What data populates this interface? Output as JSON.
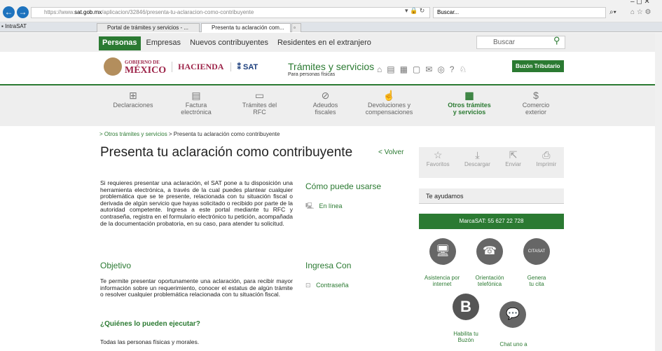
{
  "browser": {
    "url_prefix": "https://www.",
    "url_domain": "sat.gob.mx",
    "url_path": "/aplicacion/32846/presenta-tu-aclaracion-como-contribuyente",
    "search_placeholder": "Buscar...",
    "favorites_label": "IntraSAT",
    "tabs": [
      {
        "label": "Portal de trámites y servicios - ..."
      },
      {
        "label": "Presenta tu aclaración com..."
      }
    ]
  },
  "topnav": {
    "items": [
      "Personas",
      "Empresas",
      "Nuevos contribuyentes",
      "Residentes en el extranjero"
    ],
    "search_placeholder": "Buscar"
  },
  "header": {
    "gob_line1": "GOBIERNO DE",
    "gob_line2": "MÉXICO",
    "hacienda": "HACIENDA",
    "sat": "SAT",
    "tramites_title": "Trámites y servicios",
    "tramites_sub": "Para personas físicas",
    "buzon": "Buzón Tributario"
  },
  "categories": [
    {
      "l1": "Declaraciones",
      "l2": ""
    },
    {
      "l1": "Factura",
      "l2": "electrónica"
    },
    {
      "l1": "Trámites del",
      "l2": "RFC"
    },
    {
      "l1": "Adeudos",
      "l2": "fiscales"
    },
    {
      "l1": "Devoluciones y",
      "l2": "compensaciones"
    },
    {
      "l1": "Otros trámites",
      "l2": "y servicios"
    },
    {
      "l1": "Comercio",
      "l2": "exterior"
    }
  ],
  "breadcrumb": {
    "part1": "> Otros trámites y servicios",
    "part2": " > Presenta tu aclaración como contribuyente"
  },
  "page": {
    "title": "Presenta tu aclaración como contribuyente",
    "volver": "< Volver",
    "intro": "Si requieres presentar una aclaración, el SAT pone a tu disposición una herramienta electrónica, a través de la cual puedes plantear cualquier problemática que se te presente, relacionada con tu situación fiscal o derivada de algún servicio que hayas solicitado o recibido por parte de la autoridad competente. Ingresa a este portal mediante tu RFC y contraseña, registra en el formulario electrónico tu petición, acompañada de la documentación probatoria, en su caso, para atender tu solicitud.",
    "objetivo_title": "Objetivo",
    "objetivo_text": "Te permite presentar oportunamente una aclaración, para recibir mayor información sobre un requerimiento, conocer el estatus de algún trámite o resolver cualquier problemática relacionada con tu situación fiscal.",
    "quienes_title": "¿Quiénes lo pueden ejecutar?",
    "quienes_text": "Todas las personas físicas y morales.",
    "como_title": "Cómo puede usarse",
    "en_linea": "En línea",
    "ingresa_title": "Ingresa Con",
    "contrasena": "Contraseña"
  },
  "sidebar": {
    "tools": [
      "Favoritos",
      "Descargar",
      "Enviar",
      "Imprimir"
    ],
    "ayudamos": "Te ayudamos",
    "marcasat": "MarcaSAT: 55 627 22 728",
    "services": [
      {
        "l1": "Asistencia por",
        "l2": "internet"
      },
      {
        "l1": "Orientación",
        "l2": "telefónica"
      },
      {
        "l1": "Genera",
        "l2": "tu cita"
      },
      {
        "l1": "Habilita tu",
        "l2": "Buzón"
      },
      {
        "l1": "Chat uno a",
        "l2": ""
      }
    ],
    "cita_badge": "CITASAT"
  }
}
